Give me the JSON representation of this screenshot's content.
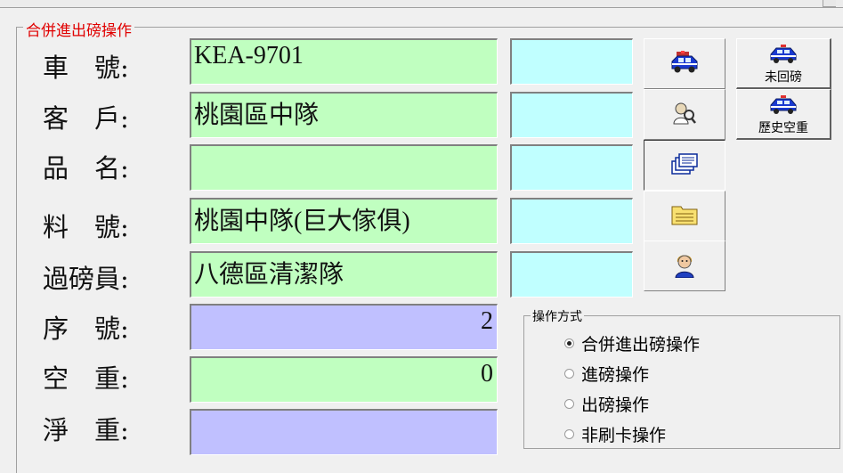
{
  "group": {
    "title": "合併進出磅操作"
  },
  "fields": [
    {
      "label": "車　號:",
      "value": "KEA-9701"
    },
    {
      "label": "客　戶:",
      "value": "桃園區中隊"
    },
    {
      "label": "品　名:",
      "value": ""
    },
    {
      "label": "料　號:",
      "value": "桃園中隊(巨大傢俱)"
    },
    {
      "label": "過磅員:",
      "value": "八德區清潔隊"
    },
    {
      "label": "序　號:",
      "value": "2"
    },
    {
      "label": "空　重:",
      "value": "0"
    },
    {
      "label": "淨　重:",
      "value": ""
    }
  ],
  "buttons": {
    "unreturned": "未回磅",
    "history_tare": "歷史空重"
  },
  "icons": [
    "car-icon",
    "person-search-icon",
    "cards-icon",
    "folder-list-icon",
    "person-icon"
  ],
  "operation_mode": {
    "title": "操作方式",
    "options": [
      "合併進出磅操作",
      "進磅操作",
      "出磅操作",
      "非刷卡操作"
    ],
    "selected": "合併進出磅操作"
  },
  "colors": {
    "field_green": "#c0ffc0",
    "field_purple": "#c0c0ff",
    "field_cyan": "#c0ffff",
    "title_red": "#e00000"
  }
}
